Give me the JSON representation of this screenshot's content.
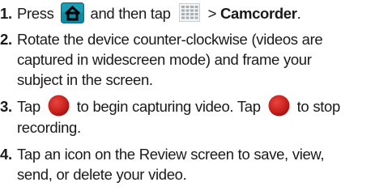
{
  "steps": [
    {
      "number": "1.",
      "text_a": "Press",
      "home_icon": "home-button-icon",
      "text_b": "and then tap",
      "apps_icon": "applications-grid-icon",
      "text_c": "> ",
      "text_bold": "Camcorder",
      "text_d": "."
    },
    {
      "number": "2.",
      "lines": [
        "Rotate the device counter-clockwise (videos are",
        "captured in widescreen mode) and frame your",
        "subject in the screen."
      ]
    },
    {
      "number": "3.",
      "text_a": "Tap",
      "record_icon_1": "record-button-icon",
      "text_b": "to begin capturing video. Tap",
      "record_icon_2": "record-button-icon",
      "text_c": "to stop",
      "line2": "recording."
    },
    {
      "number": "4.",
      "lines": [
        "Tap an icon on the Review screen to save, view,",
        "send, or delete your video."
      ]
    }
  ],
  "colors": {
    "text": "#1a1a1a",
    "home_icon_fill": "#0b8ba3",
    "record_red": "#c8201c",
    "apps_grid": "#9aa0a6"
  }
}
